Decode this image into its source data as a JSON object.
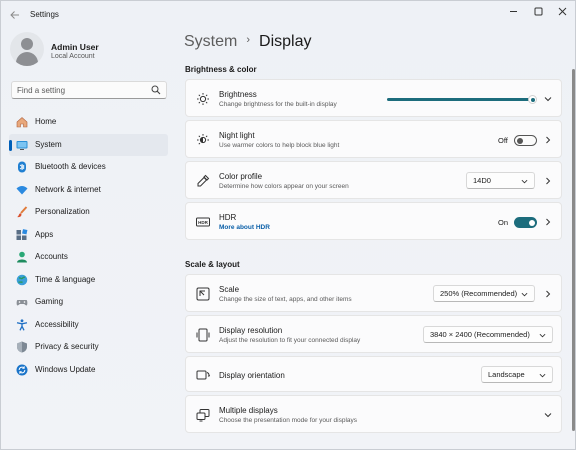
{
  "window": {
    "title": "Settings"
  },
  "profile": {
    "name": "Admin User",
    "account": "Local Account"
  },
  "search": {
    "placeholder": "Find a setting"
  },
  "sidebar": {
    "items": [
      {
        "label": "Home",
        "icon": "home-icon"
      },
      {
        "label": "System",
        "icon": "system-icon",
        "active": true
      },
      {
        "label": "Bluetooth & devices",
        "icon": "bluetooth-icon"
      },
      {
        "label": "Network & internet",
        "icon": "wifi-icon"
      },
      {
        "label": "Personalization",
        "icon": "brush-icon"
      },
      {
        "label": "Apps",
        "icon": "apps-icon"
      },
      {
        "label": "Accounts",
        "icon": "accounts-icon"
      },
      {
        "label": "Time & language",
        "icon": "globe-icon"
      },
      {
        "label": "Gaming",
        "icon": "gamepad-icon"
      },
      {
        "label": "Accessibility",
        "icon": "accessibility-icon"
      },
      {
        "label": "Privacy & security",
        "icon": "shield-icon"
      },
      {
        "label": "Windows Update",
        "icon": "update-icon"
      }
    ]
  },
  "breadcrumb": {
    "parent": "System",
    "separator": "›",
    "current": "Display"
  },
  "sections": {
    "brightness_color": "Brightness & color",
    "scale_layout": "Scale & layout"
  },
  "brightness": {
    "title": "Brightness",
    "subtitle": "Change brightness for the built-in display",
    "value_percent": 100
  },
  "night_light": {
    "title": "Night light",
    "subtitle": "Use warmer colors to help block blue light",
    "state_label": "Off",
    "on": false
  },
  "color_profile": {
    "title": "Color profile",
    "subtitle": "Determine how colors appear on your screen",
    "value": "14D0"
  },
  "hdr": {
    "title": "HDR",
    "link": "More about HDR",
    "state_label": "On",
    "on": true
  },
  "scale": {
    "title": "Scale",
    "subtitle": "Change the size of text, apps, and other items",
    "value": "250% (Recommended)"
  },
  "resolution": {
    "title": "Display resolution",
    "subtitle": "Adjust the resolution to fit your connected display",
    "value": "3840 × 2400 (Recommended)"
  },
  "orientation": {
    "title": "Display orientation",
    "value": "Landscape"
  },
  "multiple_displays": {
    "title": "Multiple displays",
    "subtitle": "Choose the presentation mode for your displays"
  },
  "colors": {
    "accent": "#1c6c7c",
    "link": "#0a5fa8",
    "selected_indicator": "#005fb8"
  }
}
